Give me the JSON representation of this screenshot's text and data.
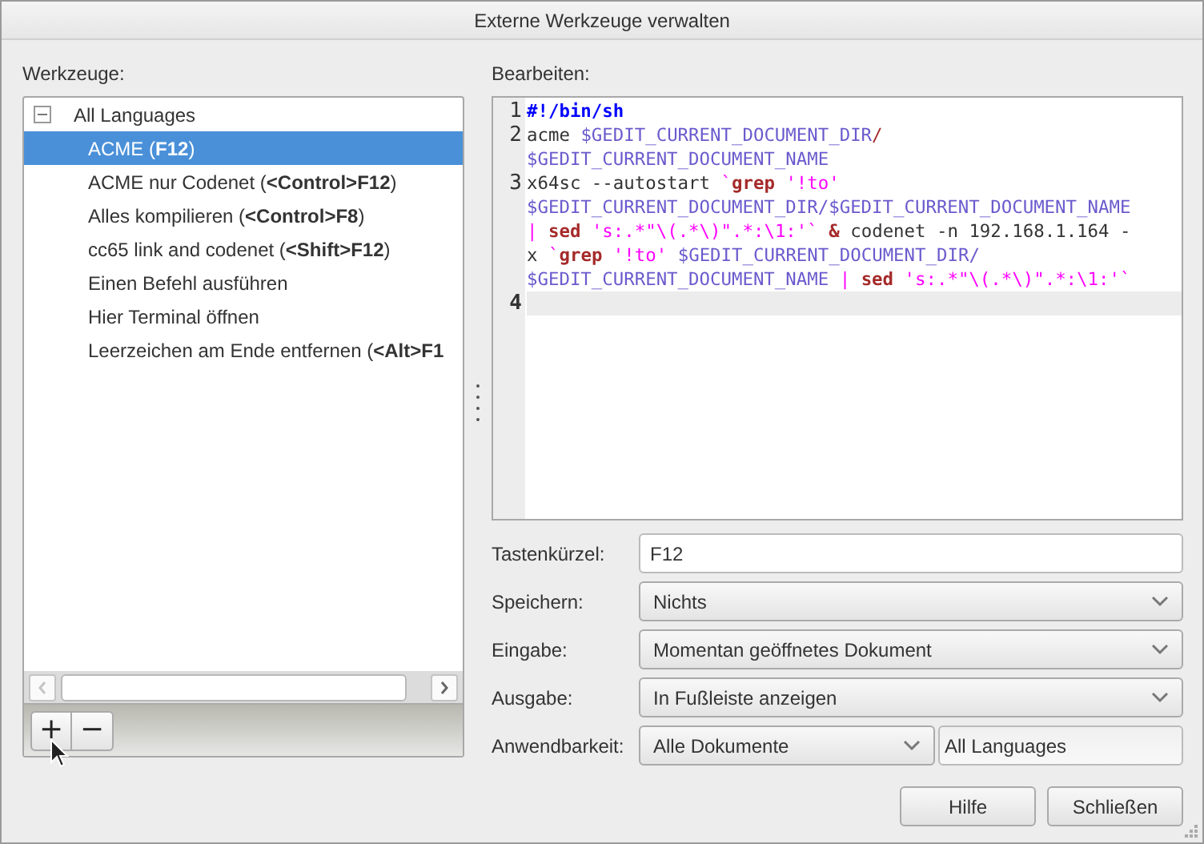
{
  "window": {
    "title": "Externe Werkzeuge verwalten"
  },
  "tools_label": "Werkzeuge:",
  "tree": [
    {
      "label": "All Languages",
      "expanded": true,
      "selected": false,
      "children": [
        {
          "label": "ACME (**F12**)",
          "selected": true
        },
        {
          "label": "ACME nur Codenet (**<Control>F12**)",
          "selected": false
        },
        {
          "label": "Alles kompilieren (**<Control>F8**)",
          "selected": false
        },
        {
          "label": "cc65 link and codenet (**<Shift>F12**)",
          "selected": false
        },
        {
          "label": "Einen Befehl ausführen",
          "selected": false
        },
        {
          "label": "Hier Terminal öffnen",
          "selected": false
        },
        {
          "label": "Leerzeichen am Ende entfernen (**<Alt>F1**",
          "selected": false
        }
      ]
    }
  ],
  "toolbar": [
    "+",
    "−"
  ],
  "editor_label": "Bearbeiten:",
  "editor": {
    "lines": [
      {
        "number": "1",
        "current": false,
        "rows": [
          {
            "tokens": [
              {
                "text": "#!/bin/sh",
                "kind": "shebang"
              }
            ]
          }
        ]
      },
      {
        "number": "2",
        "current": false,
        "rows": [
          {
            "tokens": [
              {
                "text": "acme ",
                "kind": "plain"
              },
              {
                "text": "$GEDIT_CURRENT_DOCUMENT_DIR",
                "kind": "variable"
              },
              {
                "text": "/",
                "kind": "slash"
              }
            ]
          },
          {
            "tokens": [
              {
                "text": "$GEDIT_CURRENT_DOCUMENT_NAME",
                "kind": "variable"
              }
            ]
          }
        ]
      },
      {
        "number": "3",
        "current": false,
        "rows": [
          {
            "tokens": [
              {
                "text": "x64sc --autostart ",
                "kind": "plain"
              },
              {
                "text": "`",
                "kind": "string"
              },
              {
                "text": "grep",
                "kind": "command"
              },
              {
                "text": " '!to'",
                "kind": "string"
              }
            ]
          },
          {
            "tokens": [
              {
                "text": "$GEDIT_CURRENT_DOCUMENT_DIR/$GEDIT_CURRENT_DOCUMENT_NAME",
                "kind": "variable"
              }
            ]
          },
          {
            "tokens": [
              {
                "text": "| ",
                "kind": "string"
              },
              {
                "text": "sed",
                "kind": "command"
              },
              {
                "text": " 's:.*\"\\(.*\\)\".*:\\1:'`",
                "kind": "string"
              },
              {
                "text": " &",
                "kind": "command"
              },
              {
                "text": " codenet -n 192.168.1.164 -",
                "kind": "plain"
              }
            ]
          },
          {
            "tokens": [
              {
                "text": "x ",
                "kind": "plain"
              },
              {
                "text": "`",
                "kind": "string"
              },
              {
                "text": "grep",
                "kind": "command"
              },
              {
                "text": " '!to' ",
                "kind": "string"
              },
              {
                "text": "$GEDIT_CURRENT_DOCUMENT_DIR/",
                "kind": "variable"
              }
            ]
          },
          {
            "tokens": [
              {
                "text": "$GEDIT_CURRENT_DOCUMENT_NAME",
                "kind": "variable"
              },
              {
                "text": " | ",
                "kind": "string"
              },
              {
                "text": "sed",
                "kind": "command"
              },
              {
                "text": " 's:.*\"\\(.*\\)\".*:\\1:'`",
                "kind": "string"
              }
            ]
          }
        ]
      },
      {
        "number": "4",
        "current": true
      }
    ]
  },
  "form": [
    {
      "kind": "entry",
      "label": "Tastenkürzel:",
      "value": "F12"
    },
    {
      "kind": "combo",
      "label": "Speichern:",
      "value": "Nichts"
    },
    {
      "kind": "combo",
      "label": "Eingabe:",
      "value": "Momentan geöffnetes Dokument"
    },
    {
      "kind": "combo",
      "label": "Ausgabe:",
      "value": "In Fußleiste anzeigen"
    },
    {
      "kind": "combo_entry",
      "label": "Anwendbarkeit:",
      "value": "Alle Dokumente",
      "extra": "All Languages"
    }
  ],
  "buttons": [
    "Hilfe",
    "Schließen"
  ]
}
